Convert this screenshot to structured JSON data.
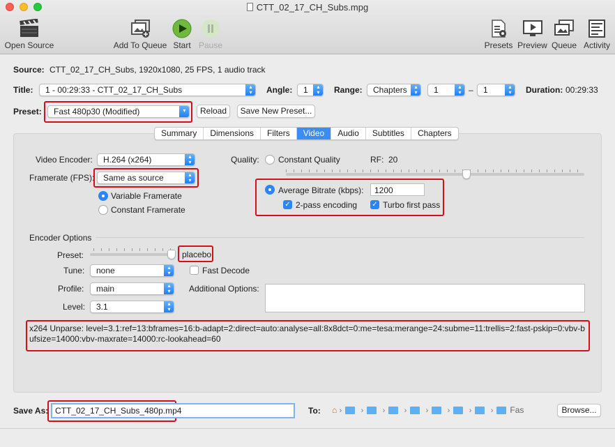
{
  "window": {
    "title": "CTT_02_17_CH_Subs.mpg"
  },
  "toolbar": {
    "open_source": "Open Source",
    "add_to_queue": "Add To Queue",
    "start": "Start",
    "pause": "Pause",
    "presets": "Presets",
    "preview": "Preview",
    "queue": "Queue",
    "activity": "Activity"
  },
  "source": {
    "label": "Source:",
    "value": "CTT_02_17_CH_Subs, 1920x1080, 25 FPS, 1 audio track"
  },
  "title_row": {
    "label": "Title:",
    "title_value": "1 - 00:29:33 - CTT_02_17_CH_Subs",
    "angle_label": "Angle:",
    "angle_value": "1",
    "range_label": "Range:",
    "range_type": "Chapters",
    "range_start": "1",
    "range_dash": "–",
    "range_end": "1",
    "duration_label": "Duration:",
    "duration_value": "00:29:33"
  },
  "preset_row": {
    "label": "Preset:",
    "value": "Fast 480p30 (Modified)",
    "reload": "Reload",
    "save_new": "Save New Preset..."
  },
  "tabs": [
    "Summary",
    "Dimensions",
    "Filters",
    "Video",
    "Audio",
    "Subtitles",
    "Chapters"
  ],
  "video": {
    "encoder_label": "Video Encoder:",
    "encoder_value": "H.264 (x264)",
    "framerate_label": "Framerate (FPS):",
    "framerate_value": "Same as source",
    "variable_framerate": "Variable Framerate",
    "constant_framerate": "Constant Framerate",
    "quality_label": "Quality:",
    "constant_quality": "Constant Quality",
    "rf_label": "RF:",
    "rf_value": "20",
    "avg_bitrate": "Average Bitrate (kbps):",
    "bitrate_value": "1200",
    "two_pass": "2-pass encoding",
    "turbo": "Turbo first pass"
  },
  "encoder_options": {
    "heading": "Encoder Options",
    "preset_label": "Preset:",
    "preset_value": "placebo",
    "tune_label": "Tune:",
    "tune_value": "none",
    "fast_decode": "Fast Decode",
    "profile_label": "Profile:",
    "profile_value": "main",
    "additional_label": "Additional Options:",
    "level_label": "Level:",
    "level_value": "3.1",
    "unparse": "x264 Unparse: level=3.1:ref=13:bframes=16:b-adapt=2:direct=auto:analyse=all:8x8dct=0:me=tesa:merange=24:subme=11:trellis=2:fast-pskip=0:vbv-bufsize=14000:vbv-maxrate=14000:rc-lookahead=60"
  },
  "save": {
    "label": "Save As:",
    "value": "CTT_02_17_CH_Subs_480p.mp4",
    "to_label": "To:",
    "path_tail": "Fas",
    "browse": "Browse..."
  }
}
